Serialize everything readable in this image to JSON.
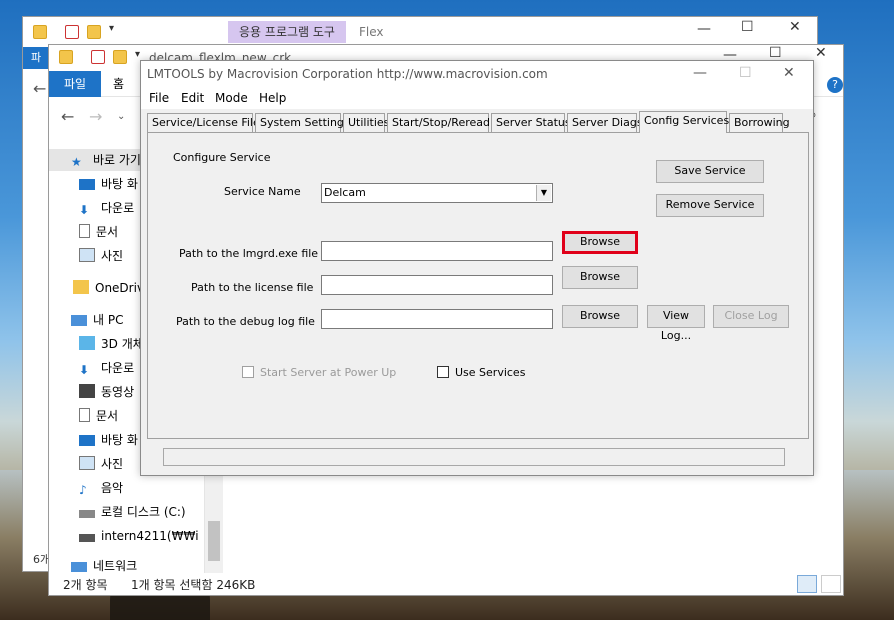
{
  "explorer_back": {
    "ribbon_context": "응용 프로그램 도구",
    "title_fragment": "Flex",
    "left_tab": "파",
    "count_fragment": "6개"
  },
  "explorer_front": {
    "title": "delcam_flexlm_new_crk",
    "ribbon_tabs": {
      "file": "파일",
      "home": "홈"
    },
    "help_label": "?",
    "nav_items": [
      {
        "label": "바로 가기",
        "icon": "star-icon"
      },
      {
        "label": "바탕 화",
        "icon": "desktop-icon"
      },
      {
        "label": "다운로",
        "icon": "download-icon"
      },
      {
        "label": "문서",
        "icon": "document-icon"
      },
      {
        "label": "사진",
        "icon": "picture-icon"
      },
      {
        "label": "OneDrive",
        "icon": "folder-icon"
      },
      {
        "label": "내 PC",
        "icon": "pc-icon"
      },
      {
        "label": "3D 개체",
        "icon": "cube-icon"
      },
      {
        "label": "다운로",
        "icon": "download-icon"
      },
      {
        "label": "동영상",
        "icon": "video-icon"
      },
      {
        "label": "문서",
        "icon": "document-icon"
      },
      {
        "label": "바탕 화",
        "icon": "desktop-icon"
      },
      {
        "label": "사진",
        "icon": "picture-icon"
      },
      {
        "label": "음악",
        "icon": "music-icon"
      },
      {
        "label": "로컬 디스크 (C:)",
        "icon": "drive-icon"
      },
      {
        "label": "intern4211(₩₩i",
        "icon": "network-drive-icon"
      },
      {
        "label": "네트워크",
        "icon": "network-icon"
      }
    ],
    "status": {
      "items": "2개 항목",
      "selected": "1개 항목 선택함 246KB"
    }
  },
  "lmtools": {
    "title": "LMTOOLS by Macrovision Corporation http://www.macrovision.com",
    "menu": [
      "File",
      "Edit",
      "Mode",
      "Help"
    ],
    "tabs": [
      "Service/License File",
      "System Settings",
      "Utilities",
      "Start/Stop/Reread",
      "Server Status",
      "Server Diags",
      "Config Services",
      "Borrowing"
    ],
    "active_tab": "Config Services",
    "configure_service_label": "Configure Service",
    "service_name_label": "Service Name",
    "service_name_value": "Delcam",
    "save_service": "Save Service",
    "remove_service": "Remove Service",
    "lmgrd_label": "Path to the lmgrd.exe file",
    "license_label": "Path to the license file",
    "debug_label": "Path to the debug log file",
    "browse": "Browse",
    "view_log": "View Log...",
    "close_log": "Close Log",
    "start_server_label": "Start Server at Power Up",
    "use_services_label": "Use Services",
    "highlight_color": "#e0001a"
  }
}
